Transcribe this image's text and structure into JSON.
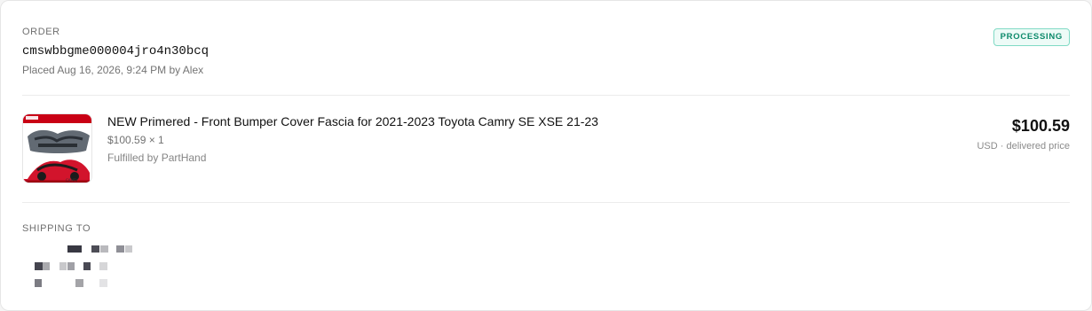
{
  "order": {
    "kicker": "ORDER",
    "id": "cmswbbgme000004jro4n30bcq",
    "placed_meta": "Placed Aug 16, 2026, 9:24 PM by Alex",
    "status": "PROCESSING"
  },
  "line_item": {
    "thumbnail_alt": "Front bumper cover fascia product image",
    "title": "NEW Primered - Front Bumper Cover Fascia for 2021-2023 Toyota Camry SE XSE 21-23",
    "unit_price_quantity": "$100.59 × 1",
    "fulfillment": "Fulfilled by PartHand",
    "total_price": "$100.59",
    "price_note": "USD · delivered price"
  },
  "shipping": {
    "title": "SHIPPING TO",
    "address_redacted": true
  },
  "colors": {
    "status_text": "#0d8a6b",
    "status_border": "#80dac5",
    "status_background": "#edfbf7",
    "divider": "#ececec"
  }
}
